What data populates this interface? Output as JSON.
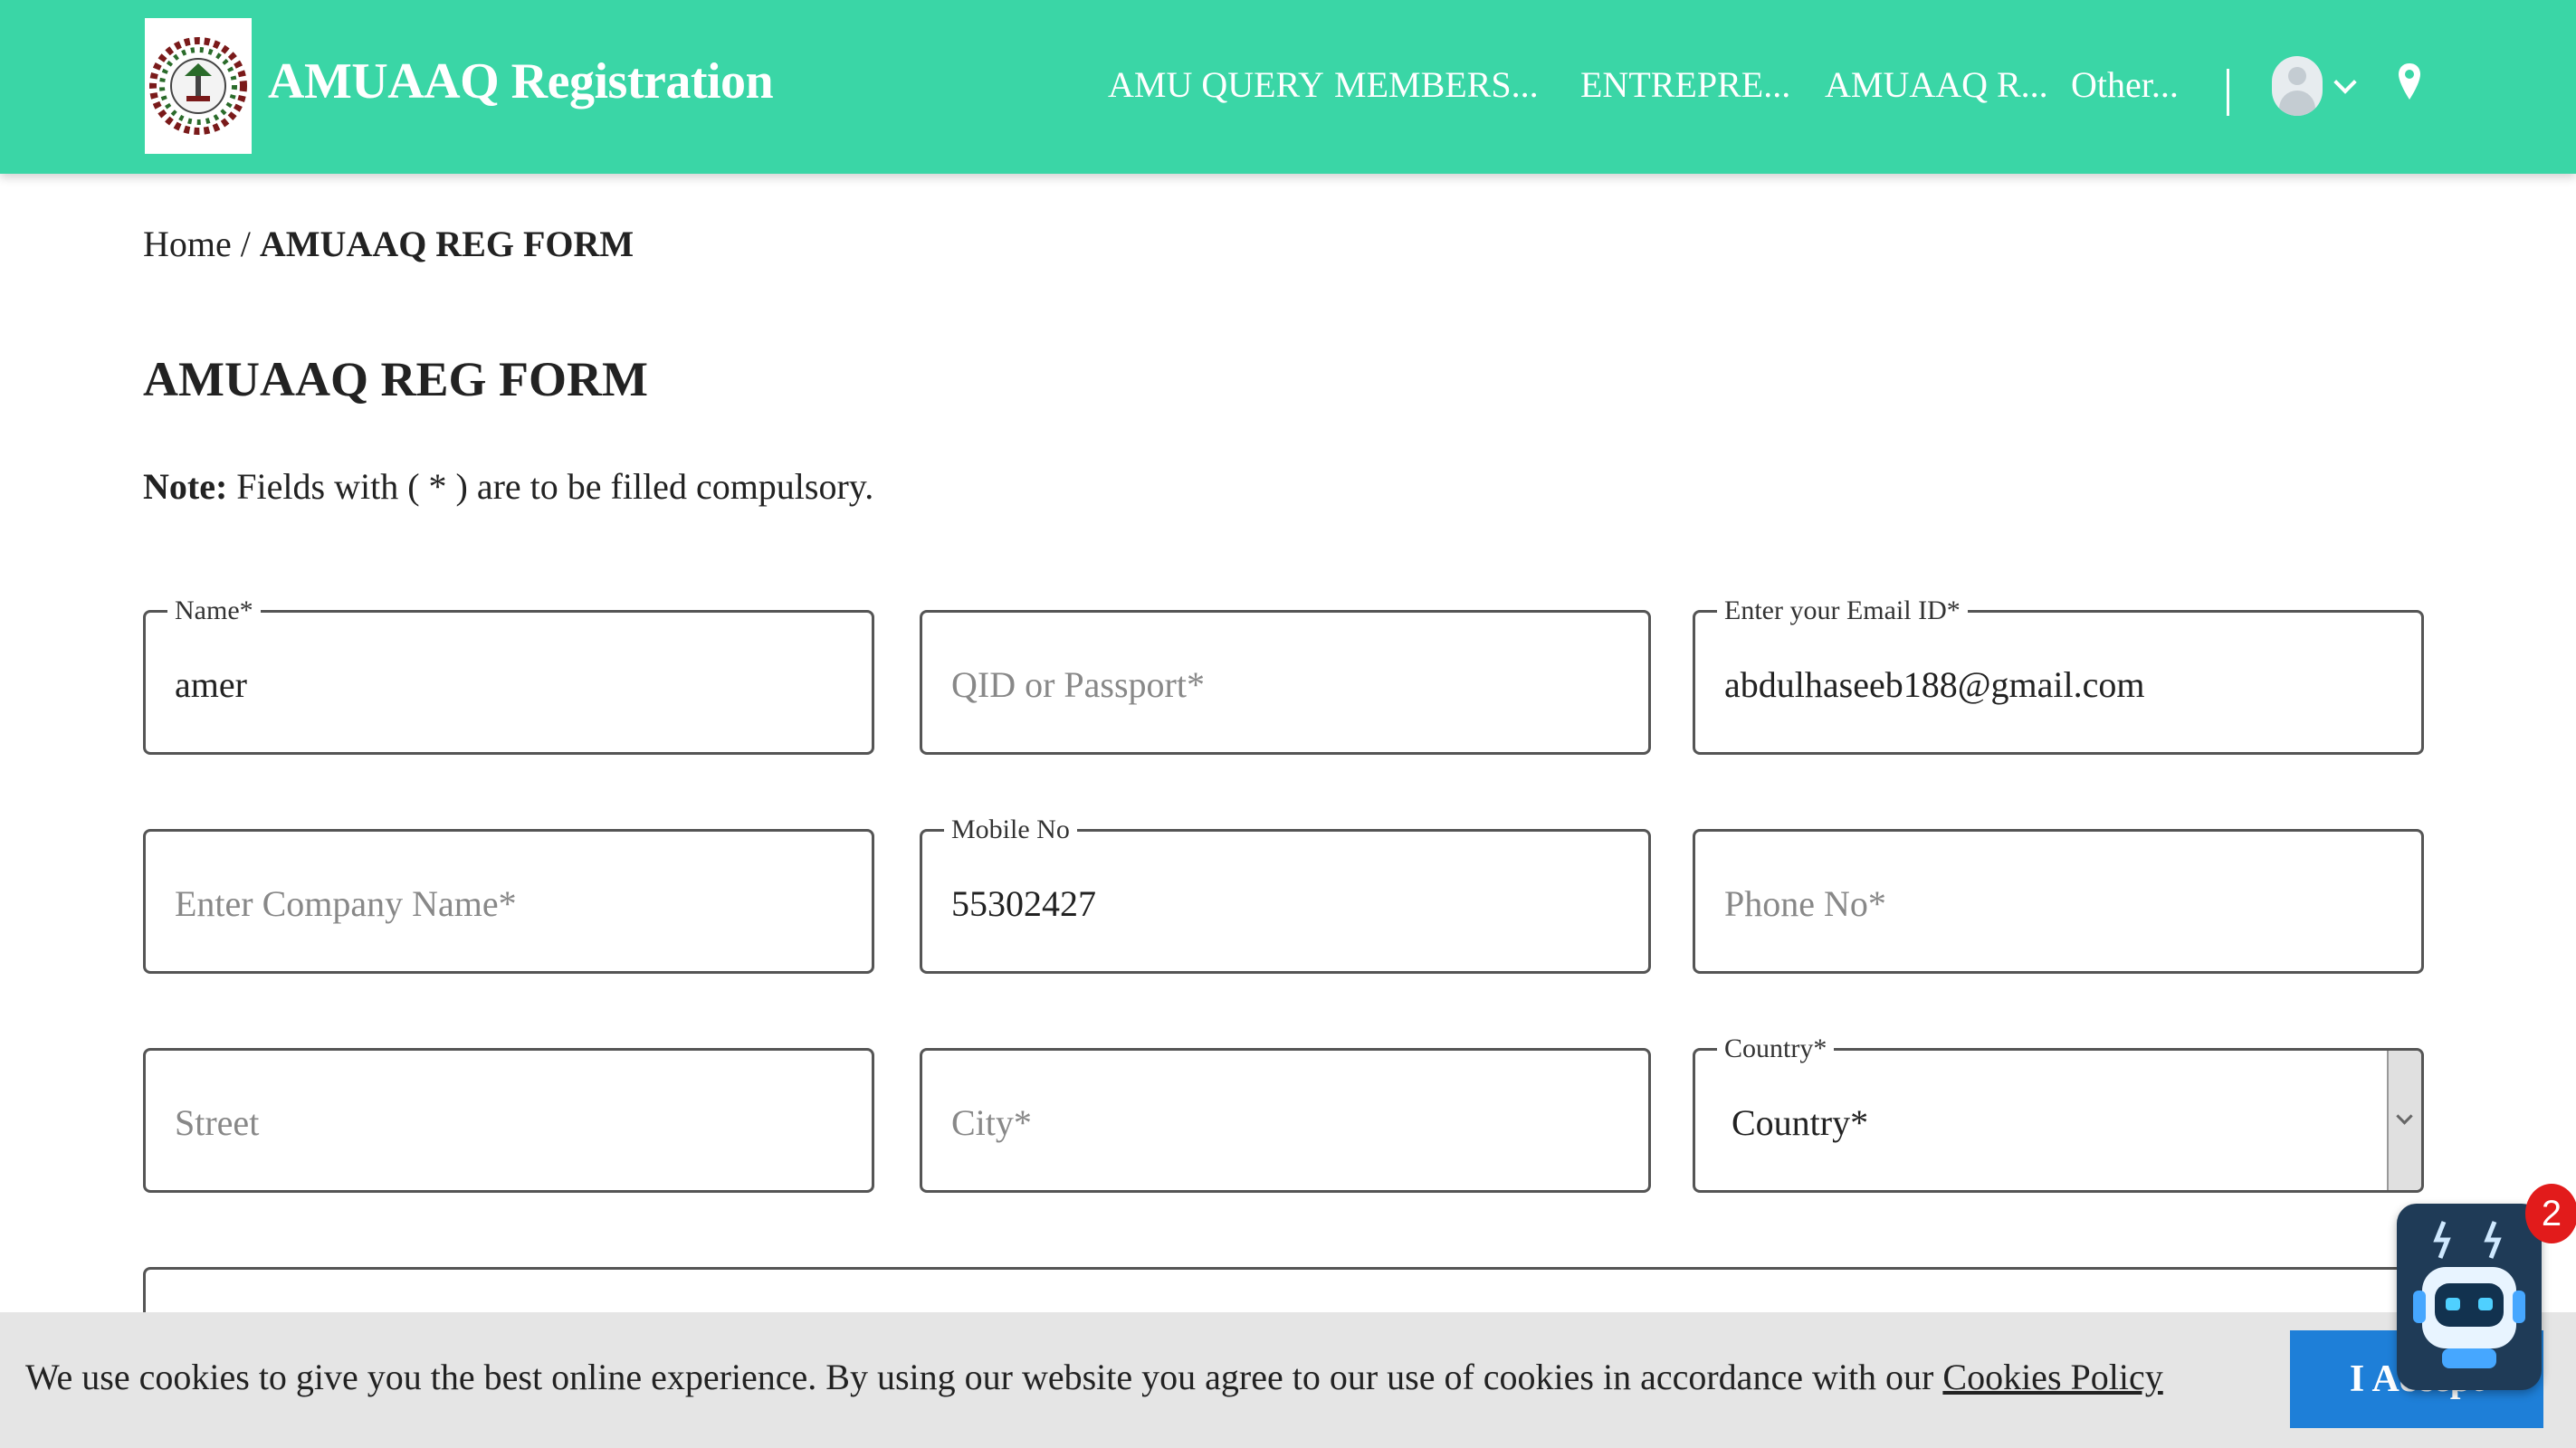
{
  "header": {
    "brand": "AMUAAQ Registration",
    "nav": [
      "AMU QUERY",
      "MEMBERS...",
      "ENTREPRE...",
      "AMUAAQ R...",
      "Other..."
    ],
    "bg_color": "#3ad6a6"
  },
  "breadcrumb": {
    "home": "Home",
    "separator": " / ",
    "current": "AMUAAQ REG FORM"
  },
  "page": {
    "title": "AMUAAQ REG FORM",
    "note_label": "Note:",
    "note_text": " Fields with ( * ) are to be filled compulsory."
  },
  "form": {
    "name": {
      "label": "Name*",
      "value": "amer",
      "placeholder": ""
    },
    "qid": {
      "label": "",
      "value": "",
      "placeholder": "QID or Passport*"
    },
    "email": {
      "label": "Enter your Email ID*",
      "value": "abdulhaseeb188@gmail.com",
      "placeholder": ""
    },
    "company": {
      "label": "",
      "value": "",
      "placeholder": "Enter Company Name*"
    },
    "mobile": {
      "label": "Mobile No",
      "value": "55302427",
      "placeholder": ""
    },
    "phone": {
      "label": "",
      "value": "",
      "placeholder": "Phone No*"
    },
    "street": {
      "label": "",
      "value": "",
      "placeholder": "Street"
    },
    "city": {
      "label": "",
      "value": "",
      "placeholder": "City*"
    },
    "country": {
      "label": "Country*",
      "selected": "Country*"
    }
  },
  "cookie": {
    "text": "We use cookies to give you the best online experience. By using our website you agree to our use of cookies in accordance with our ",
    "link": "Cookies Policy",
    "accept_label": "I Accept",
    "accept_color": "#1e7fd8"
  },
  "chatbot": {
    "badge_count": "2"
  },
  "icons": [
    "logo-icon",
    "user-avatar-icon",
    "chevron-down-icon",
    "location-pin-icon",
    "chatbot-icon"
  ]
}
